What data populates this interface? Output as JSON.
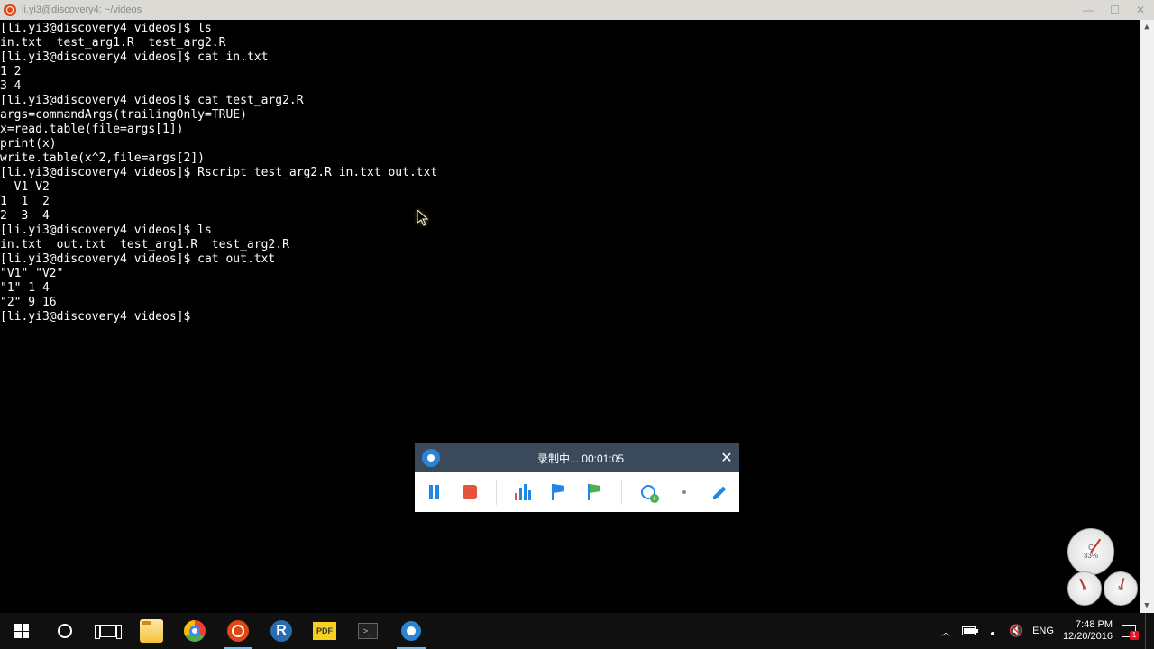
{
  "titlebar": {
    "title": "li.yi3@discovery4: ~/videos"
  },
  "terminal": {
    "lines": [
      {
        "t": "p",
        "txt": "[li.yi3@discovery4 videos]$ ",
        "cmd": "ls"
      },
      {
        "t": "o",
        "txt": "in.txt  test_arg1.R  test_arg2.R"
      },
      {
        "t": "p",
        "txt": "[li.yi3@discovery4 videos]$ ",
        "cmd": "cat in.txt"
      },
      {
        "t": "o",
        "txt": "1 2"
      },
      {
        "t": "o",
        "txt": "3 4"
      },
      {
        "t": "p",
        "txt": "[li.yi3@discovery4 videos]$ ",
        "cmd": "cat test_arg2.R"
      },
      {
        "t": "o",
        "txt": "args=commandArgs(trailingOnly=TRUE)"
      },
      {
        "t": "o",
        "txt": "x=read.table(file=args[1])"
      },
      {
        "t": "o",
        "txt": "print(x)"
      },
      {
        "t": "o",
        "txt": "write.table(x^2,file=args[2])"
      },
      {
        "t": "o",
        "txt": ""
      },
      {
        "t": "p",
        "txt": "[li.yi3@discovery4 videos]$ ",
        "cmd": "Rscript test_arg2.R in.txt out.txt"
      },
      {
        "t": "o",
        "txt": "  V1 V2"
      },
      {
        "t": "o",
        "txt": "1  1  2"
      },
      {
        "t": "o",
        "txt": "2  3  4"
      },
      {
        "t": "p",
        "txt": "[li.yi3@discovery4 videos]$ ",
        "cmd": "ls"
      },
      {
        "t": "o",
        "txt": "in.txt  out.txt  test_arg1.R  test_arg2.R"
      },
      {
        "t": "p",
        "txt": "[li.yi3@discovery4 videos]$ ",
        "cmd": "cat out.txt"
      },
      {
        "t": "o",
        "txt": "\"V1\" \"V2\""
      },
      {
        "t": "o",
        "txt": "\"1\" 1 4"
      },
      {
        "t": "o",
        "txt": "\"2\" 9 16"
      },
      {
        "t": "p",
        "txt": "[li.yi3@discovery4 videos]$ ",
        "cmd": ""
      }
    ]
  },
  "recorder": {
    "title": "录制中... 00:01:05"
  },
  "gauges": {
    "cpu_label": "C",
    "cpu_pct": "33%",
    "d_label": "D",
    "m_label": "M"
  },
  "taskbar": {
    "lang": "ENG",
    "time": "7:48 PM",
    "date": "12/20/2016",
    "pdf_label": "PDF",
    "r_label": "R",
    "cmd_label": ">_"
  }
}
